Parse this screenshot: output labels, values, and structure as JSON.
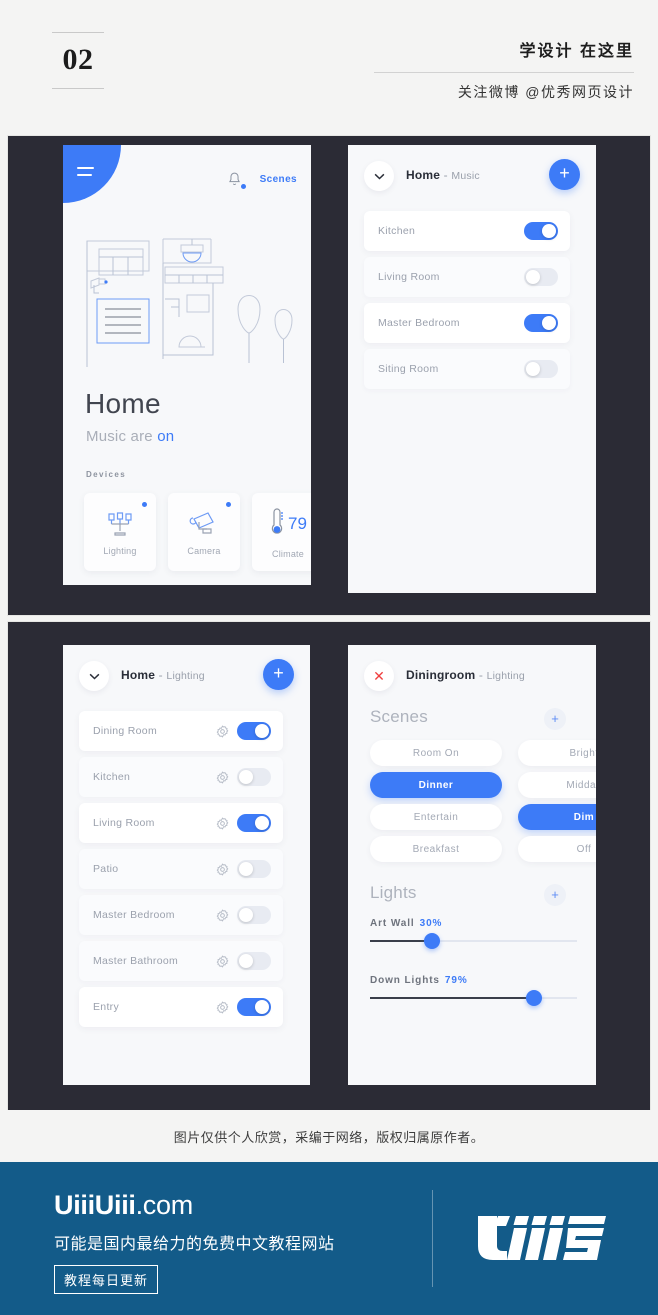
{
  "header": {
    "number": "02",
    "title": "学设计 在这里",
    "subtitle": "关注微博 @优秀网页设计"
  },
  "colors": {
    "accent": "#3d7bf7",
    "panel_dark": "#2b2b35",
    "phone_bg": "#f7f8fa",
    "footer_blue": "#135b89",
    "close_red": "#ef3f3f"
  },
  "phone1": {
    "menu_icon": "hamburger-icon",
    "bell_icon": "bell-icon",
    "scenes_link": "Scenes",
    "title": "Home",
    "subtitle_prefix": "Music are ",
    "subtitle_state": "on",
    "devices_label": "Devices",
    "devices": [
      {
        "name": "Lighting",
        "icon": "candelabra-icon",
        "active": true
      },
      {
        "name": "Camera",
        "icon": "security-camera-icon",
        "active": true
      },
      {
        "name": "Climate",
        "icon": "thermometer-icon",
        "active": false,
        "value": "79"
      }
    ]
  },
  "phone2": {
    "chevron_icon": "chevron-down-icon",
    "title": "Home",
    "separator": " - ",
    "subtitle": "Music",
    "add_label": "+",
    "rows": [
      {
        "label": "Kitchen",
        "on": true
      },
      {
        "label": "Living Room",
        "on": false
      },
      {
        "label": "Master Bedroom",
        "on": true
      },
      {
        "label": "Siting Room",
        "on": false
      }
    ]
  },
  "phone3": {
    "chevron_icon": "chevron-down-icon",
    "title": "Home",
    "separator": " - ",
    "subtitle": "Lighting",
    "add_label": "+",
    "rows": [
      {
        "label": "Dining Room",
        "on": true
      },
      {
        "label": "Kitchen",
        "on": false
      },
      {
        "label": "Living Room",
        "on": true
      },
      {
        "label": "Patio",
        "on": false
      },
      {
        "label": "Master Bedroom",
        "on": false
      },
      {
        "label": "Master Bathroom",
        "on": false
      },
      {
        "label": "Entry",
        "on": true
      }
    ]
  },
  "phone4": {
    "close_icon": "close-x-icon",
    "title": "Diningroom",
    "separator": " - ",
    "subtitle": "Lighting",
    "scenes_heading": "Scenes",
    "scenes_add": "+",
    "scenes": [
      {
        "label": "Room On",
        "active": false
      },
      {
        "label": "Bright",
        "active": false
      },
      {
        "label": "Dinner",
        "active": true
      },
      {
        "label": "Midday",
        "active": false
      },
      {
        "label": "Entertain",
        "active": false
      },
      {
        "label": "Dim",
        "active": true
      },
      {
        "label": "Breakfast",
        "active": false
      },
      {
        "label": "Off",
        "active": false
      }
    ],
    "lights_heading": "Lights",
    "lights_add": "+",
    "sliders": [
      {
        "label": "Art Wall",
        "percent": "30%",
        "value": 30
      },
      {
        "label": "Down Lights",
        "percent": "79%",
        "value": 79
      }
    ]
  },
  "caption": "图片仅供个人欣赏，采编于网络，版权归属原作者。",
  "footer": {
    "brand_bold": "UiiiUiii",
    "brand_rest": ".com",
    "tagline": "可能是国内最给力的免费中文教程网站",
    "badge": "教程每日更新",
    "logo_icon": "uiii-logo-icon"
  }
}
